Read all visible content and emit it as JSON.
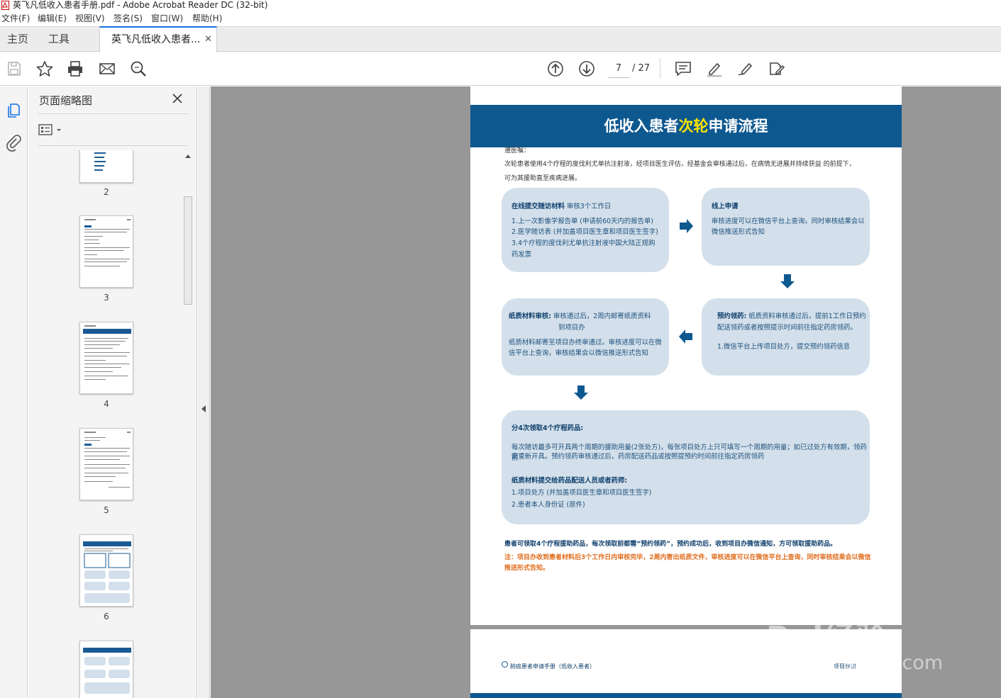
{
  "window": {
    "title": "英飞凡低收入患者手册.pdf - Adobe Acrobat Reader DC (32-bit)"
  },
  "menu": [
    "文件(F)",
    "编辑(E)",
    "视图(V)",
    "签名(S)",
    "窗口(W)",
    "帮助(H)"
  ],
  "tabs": {
    "home": "主页",
    "tools": "工具",
    "document": "英飞凡低收入患者..."
  },
  "toolbar": {
    "page_current": "7",
    "page_total": "/ 27"
  },
  "panel": {
    "title": "页面缩略图",
    "thumb_labels": [
      "2",
      "3",
      "4",
      "5",
      "6"
    ]
  },
  "page": {
    "title_a": "低收入患者",
    "title_b": "次轮",
    "title_c": "申请流程",
    "note_head": "遵医嘱：",
    "intro_1": "次轮患者使用4个疗程的度伐利尤单抗注射液，经项目医生评估，经基金会审核通过后，在病情无进展并持续获益 的前提下，",
    "intro_2": "可为其援助直至疾病进展。",
    "b1_title": "在线提交随访材料",
    "b1_sub": " 审核3个工作日",
    "b1_l1": "1.上一次影像学报告单 (申请前60天内的报告单)",
    "b1_l2": "2.医学随访表 (并加盖项目医生章和项目医生签字)",
    "b1_l3": "3.4个疗程的度伐利尤单抗注射液中国大陆正规购",
    "b1_l4": "药发票",
    "b2_title": "线上申请",
    "b2_l1": "审核进度可以在微信平台上查询，同时审核结果会以",
    "b2_l2": "微信推送形式告知",
    "b3_title": "纸质材料审核:",
    "b3_l1": " 审核通过后，2周内邮寄纸质资料",
    "b3_l2": "到项目办",
    "b3_l3": "纸质材料邮寄至项目办终审通过。审核进度可以在微",
    "b3_l4": "信平台上查询，审核结果会以微信推送形式告知",
    "b4_title": "预约领药:",
    "b4_l1": " 纸质资料审核通过后，提前1工作日预约",
    "b4_l2": "配送领药或者按照提示时间前往指定药房领药。",
    "b4_l3": "1.微信平台上传项目处方，提交预约领药信息",
    "b5_title": "分4次领取4个疗程药品:",
    "b5_l1": "每次随访最多可开具两个周期的援助用量(2张处方)，每张项目处方上只可填写一个周期的用量；如已过处方有效期，领药前",
    "b5_l2": "需重新开具。预约领药审核通过后，药房配送药品或按照提预约时间前往指定药房领药",
    "b5_title2": "纸质材料提交给药品配送人员或者药师:",
    "b5_l3": "1.项目处方 (并加盖项目医生章和项目医生签字)",
    "b5_l4": "2.患者本人身份证 (原件)",
    "foot1": "患者可领取4个疗程援助药品，每次领取前都需“预约领药”，预约成功后，收到项目办微信通知，方可领取援助药品。",
    "foot2": "注：项目办收到患者材料后3个工作日内审核完毕，2周内寄出纸质文件，审核进度可以在微信平台上查询，同时审核结果会以微信推送形式告知。",
    "p2_footer": "肺癌患者申请手册（低收入患者）",
    "p2_right": "项目标识"
  },
  "watermark": {
    "brand": "Bai经验",
    "url": "jingyan.baidu.com"
  },
  "colors": {
    "accent": "#1473e6",
    "banner": "#0e5890",
    "highlight": "#ffe600",
    "box": "#d3e0eb",
    "warning": "#e06c1c"
  }
}
